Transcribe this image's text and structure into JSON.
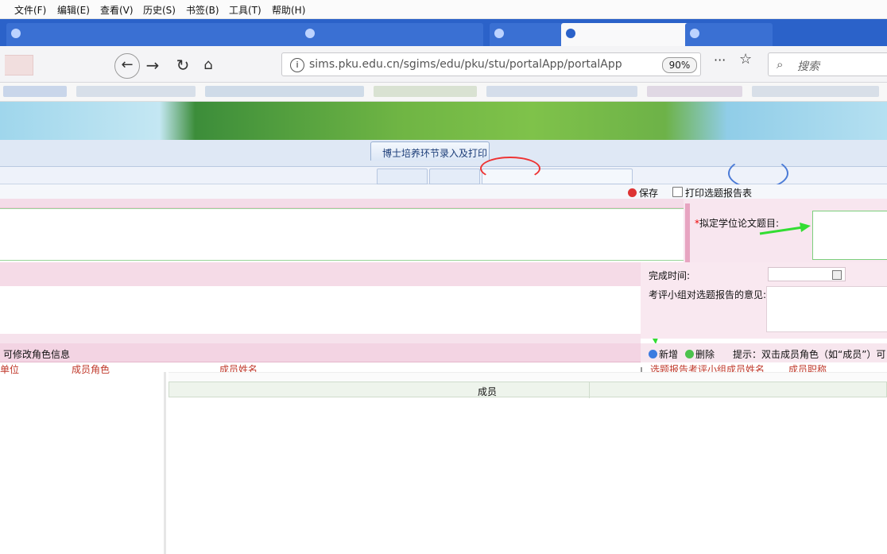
{
  "menu": [
    "文件(F)",
    "编辑(E)",
    "查看(V)",
    "历史(S)",
    "书签(B)",
    "工具(T)",
    "帮助(H)"
  ],
  "browser": {
    "url": "sims.pku.edu.cn/sgims/edu/pku/stu/portalApp/portalApp",
    "zoom": "90%",
    "more": "···",
    "search_placeholder": "搜索"
  },
  "app": {
    "main_tab": "博士培养环节录入及打印",
    "toolbar": {
      "save": "保存",
      "print": "打印选题报告表"
    },
    "form": {
      "required_mark": "*",
      "thesis_title_label": "拟定学位论文题目:",
      "completion_time_label": "完成时间:",
      "opinion_label": "考评小组对选题报告的意见:"
    },
    "members_grid": {
      "caption": "可修改角色信息",
      "columns_left": [
        "单位",
        "成员角色",
        "成员姓名"
      ],
      "add": "新增",
      "delete": "删除",
      "hint": "提示：双击成员角色（如“成员”）可",
      "columns_right": [
        "选题报告考评小组成员姓名",
        "成员职称"
      ]
    },
    "popup": {
      "column": "成员"
    }
  },
  "colors": {
    "accent": "#2b62c9",
    "pink": "#f8e6ef",
    "green_arrow": "#33dd33",
    "red_circle": "#e33333"
  }
}
